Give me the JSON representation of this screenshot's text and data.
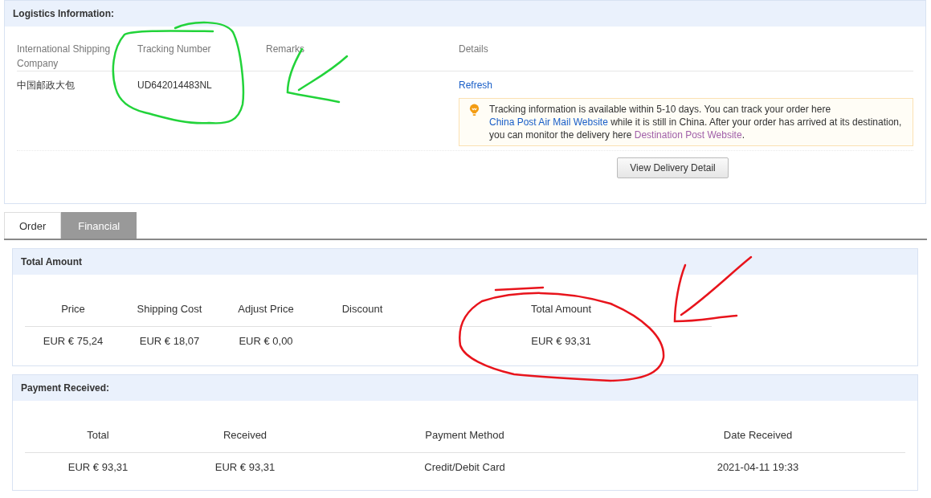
{
  "logistics": {
    "title": "Logistics Information:",
    "columns": [
      "International Shipping Company",
      "Tracking Number",
      "Remarks",
      "Details"
    ],
    "row": {
      "company": "中国邮政大包",
      "tracking_number": "UD642014483NL",
      "refresh": "Refresh"
    },
    "notice": [
      {
        "kind": "text",
        "text": "Tracking information is available within 5-10 days. You can track your order here "
      },
      {
        "kind": "link",
        "text": "China Post Air Mail Website",
        "visited": false
      },
      {
        "kind": "text",
        "text": " while it is still in China. After your order has arrived at its destination, you can monitor the delivery here "
      },
      {
        "kind": "link",
        "text": "Destination Post Website",
        "visited": true
      },
      {
        "kind": "text",
        "text": "."
      }
    ],
    "button": "View Delivery Detail"
  },
  "tabs": [
    {
      "label": "Order",
      "selected": false
    },
    {
      "label": "Financial",
      "selected": true
    }
  ],
  "total_amount": {
    "title": "Total Amount",
    "columns": [
      "Price",
      "Shipping Cost",
      "Adjust Price",
      "Discount",
      "Total Amount"
    ],
    "rows": [
      [
        "EUR € 75,24",
        "EUR € 18,07",
        "EUR € 0,00",
        "",
        "EUR € 93,31"
      ]
    ]
  },
  "payment_received": {
    "title": "Payment Received:",
    "columns": [
      "Total",
      "Received",
      "Payment Method",
      "Date Received"
    ],
    "rows": [
      [
        "EUR € 93,31",
        "EUR € 93,31",
        "Credit/Debit Card",
        "2021-04-11 19:33"
      ]
    ]
  }
}
